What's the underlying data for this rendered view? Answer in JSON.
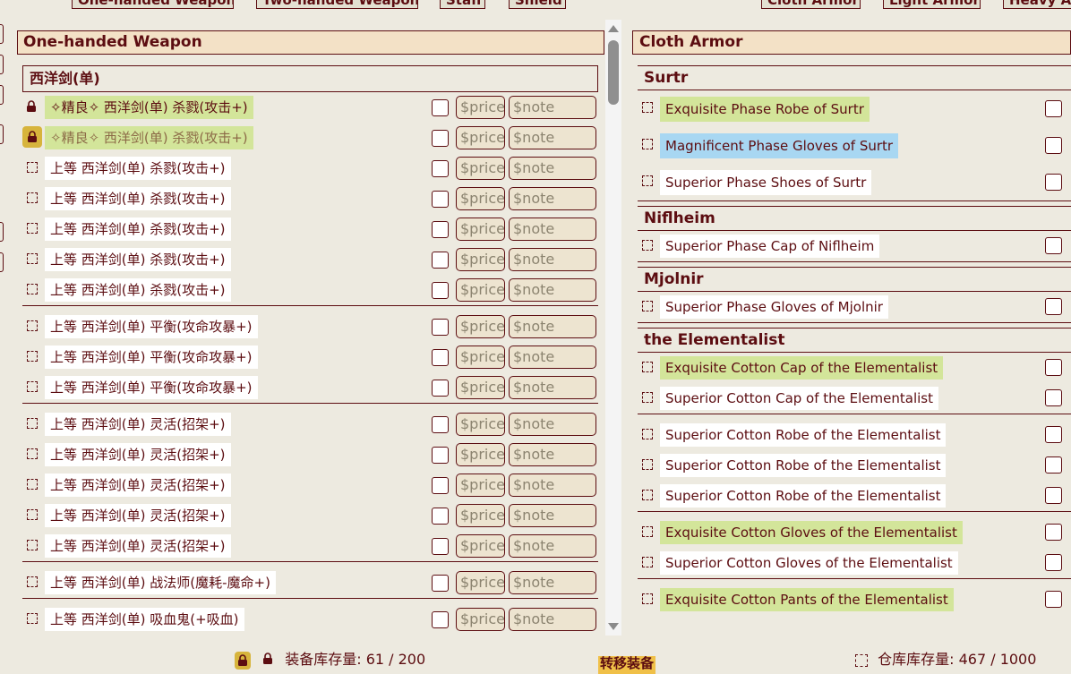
{
  "top_tabs_left": [
    "One-handed Weapon",
    "Two-handed Weapon",
    "Staff",
    "Shield"
  ],
  "top_tabs_right": [
    "Cloth Armor",
    "Light Armor",
    "Heavy Armor"
  ],
  "left_panel": {
    "title": "One-handed Weapon",
    "group_title": "西洋剑(单)",
    "price_placeholder": "$price",
    "note_placeholder": "$note",
    "rows": [
      {
        "icon": "lock-icon",
        "label": "✧精良✧ 西洋剑(单) 杀戮(攻击+)",
        "hl": "green"
      },
      {
        "icon": "lock-gold-icon",
        "label": "✧精良✧ 西洋剑(单) 杀戮(攻击+)",
        "hl": "green-dim"
      },
      {
        "icon": "select-icon",
        "label": "上等 西洋剑(单) 杀戮(攻击+)",
        "hl": ""
      },
      {
        "icon": "select-icon",
        "label": "上等 西洋剑(单) 杀戮(攻击+)",
        "hl": ""
      },
      {
        "icon": "select-icon",
        "label": "上等 西洋剑(单) 杀戮(攻击+)",
        "hl": ""
      },
      {
        "icon": "select-icon",
        "label": "上等 西洋剑(单) 杀戮(攻击+)",
        "hl": ""
      },
      {
        "icon": "select-icon",
        "label": "上等 西洋剑(单) 杀戮(攻击+)",
        "hl": ""
      },
      {
        "icon": "select-icon",
        "label": "上等 西洋剑(单) 平衡(攻命攻暴+)",
        "hl": ""
      },
      {
        "icon": "select-icon",
        "label": "上等 西洋剑(单) 平衡(攻命攻暴+)",
        "hl": ""
      },
      {
        "icon": "select-icon",
        "label": "上等 西洋剑(单) 平衡(攻命攻暴+)",
        "hl": ""
      },
      {
        "icon": "select-icon",
        "label": "上等 西洋剑(单) 灵活(招架+)",
        "hl": ""
      },
      {
        "icon": "select-icon",
        "label": "上等 西洋剑(单) 灵活(招架+)",
        "hl": ""
      },
      {
        "icon": "select-icon",
        "label": "上等 西洋剑(单) 灵活(招架+)",
        "hl": ""
      },
      {
        "icon": "select-icon",
        "label": "上等 西洋剑(单) 灵活(招架+)",
        "hl": ""
      },
      {
        "icon": "select-icon",
        "label": "上等 西洋剑(单) 灵活(招架+)",
        "hl": ""
      },
      {
        "icon": "select-icon",
        "label": "上等 西洋剑(单) 战法师(魔耗-魔命+)",
        "hl": ""
      },
      {
        "icon": "select-icon",
        "label": "上等 西洋剑(单) 吸血鬼(+吸血)",
        "hl": ""
      }
    ]
  },
  "right_panel": {
    "title": "Cloth Armor",
    "groups": [
      {
        "title": "Surtr",
        "items": [
          {
            "label": "Exquisite Phase Robe of Surtr",
            "hl": "green"
          },
          {
            "label": "Magnificent Phase Gloves of Surtr",
            "hl": "blue"
          },
          {
            "label": "Superior Phase Shoes of Surtr",
            "hl": ""
          }
        ]
      },
      {
        "title": "Niflheim",
        "items": [
          {
            "label": "Superior Phase Cap of Niflheim",
            "hl": ""
          }
        ]
      },
      {
        "title": "Mjolnir",
        "items": [
          {
            "label": "Superior Phase Gloves of Mjolnir",
            "hl": ""
          }
        ]
      },
      {
        "title": "the Elementalist",
        "items": [
          {
            "label": "Exquisite Cotton Cap of the Elementalist",
            "hl": "green"
          },
          {
            "label": "Superior Cotton Cap of the Elementalist",
            "hl": ""
          },
          {
            "label": "Superior Cotton Robe of the Elementalist",
            "hl": ""
          },
          {
            "label": "Superior Cotton Robe of the Elementalist",
            "hl": ""
          },
          {
            "label": "Superior Cotton Robe of the Elementalist",
            "hl": ""
          },
          {
            "label": "Exquisite Cotton Gloves of the Elementalist",
            "hl": "green"
          },
          {
            "label": "Superior Cotton Gloves of the Elementalist",
            "hl": ""
          },
          {
            "label": "Exquisite Cotton Pants of the Elementalist",
            "hl": "green"
          }
        ]
      }
    ]
  },
  "footer": {
    "equip_storage_label": "装备库存量:",
    "equip_storage_value": "61 / 200",
    "transfer_label": "转移装备",
    "warehouse_label": "仓库库存量:",
    "warehouse_value": "467 / 1000"
  },
  "colors": {
    "text": "#5c0d11",
    "background": "#edeae0",
    "header_bg": "#f3e1c6",
    "highlight_green": "#d3e59a",
    "highlight_blue": "#a8d7f2",
    "accent_gold": "#d7b43c"
  }
}
